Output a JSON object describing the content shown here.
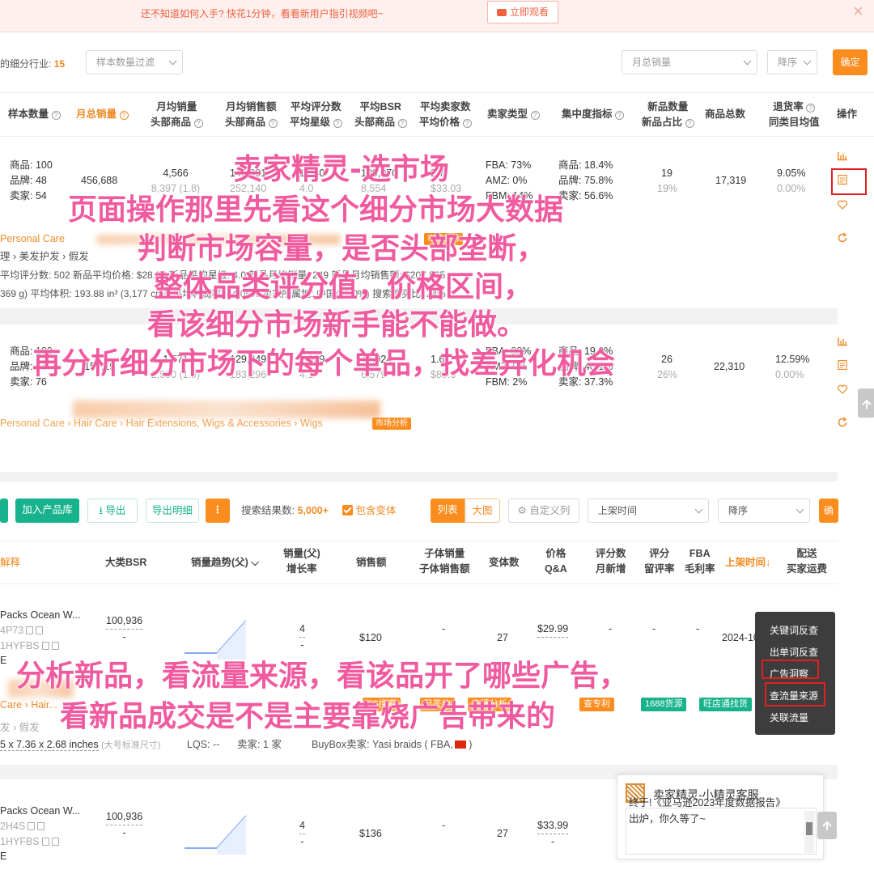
{
  "banner": {
    "text": "还不知道如何入手? 快花1分钟，看看新用户指引视频吧~",
    "watch_label": "立即观看"
  },
  "filter": {
    "label_prefix": "的细分行业:",
    "count": "15",
    "sample_placeholder": "样本数量过滤",
    "sort_field": "月总销量",
    "sort_order": "降序",
    "confirm": "确定"
  },
  "market_headers": [
    {
      "l1": "样本数量",
      "l2": ""
    },
    {
      "l1": "月总销量",
      "l2": ""
    },
    {
      "l1": "月均销量",
      "l2": "头部商品"
    },
    {
      "l1": "月均销售额",
      "l2": "头部商品"
    },
    {
      "l1": "平均评分数",
      "l2": "平均星级"
    },
    {
      "l1": "平均BSR",
      "l2": "头部商品"
    },
    {
      "l1": "平均卖家数",
      "l2": "平均价格"
    },
    {
      "l1": "卖家类型",
      "l2": ""
    },
    {
      "l1": "集中度指标",
      "l2": ""
    },
    {
      "l1": "新品数量",
      "l2": "新品占比"
    },
    {
      "l1": "商品总数",
      "l2": ""
    },
    {
      "l1": "退货率",
      "l2": "同类目均值"
    },
    {
      "l1": "操作",
      "l2": ""
    }
  ],
  "row1": {
    "sample": [
      "商品: 100",
      "品牌: 48",
      "卖家: 54"
    ],
    "monthly_total": "456,688",
    "avg_sales": "4,566",
    "avg_sales_top": "8,397 (1.8)",
    "avg_revenue": "145,091",
    "avg_revenue_top": "252,140",
    "rating_count": "1,540",
    "rating_star": "4.0",
    "bsr": "109,070",
    "bsr_top": "8,554",
    "sellers": "2.7",
    "price": "$33.03",
    "seller_type": [
      "FBA: 73%",
      "AMZ: 0%",
      "FBM: 14%"
    ],
    "concentration": [
      "商品: 18.4%",
      "品牌: 75.8%",
      "卖家: 56.6%"
    ],
    "new_count": "19",
    "new_pct": "19%",
    "total": "17,319",
    "return_rate": "9.05%",
    "return_avg": "0.00%",
    "category": "Personal Care",
    "path": "理 › 美发护发 › 假发",
    "tag": "市场分析",
    "meta1": "平均评分数: 502    新品平均价格: $28.03    新品平均星级: 4.0    新品月均销量: 249    新品月均销售额: $207,565",
    "meta2": "369 g)    平均体积: 193.88 in³ (3,177 cm³)    平均利润率: 64.05%    卖家所属地: 中国(75.0%)    搜索购买比: 24%"
  },
  "row2": {
    "sample": [
      "商品: 100",
      "品牌: 74",
      "卖家: 76"
    ],
    "monthly_total": "157,19",
    "avg_sales": "1,571",
    "avg_sales_top": "2,990 (1.9)",
    "avg_revenue": "129,949",
    "avg_revenue_top": "183,296",
    "rating_count": "1,929",
    "rating_star": "4.1",
    "bsr": "44,924",
    "bsr_top": "6,579",
    "sellers": "1.6",
    "price": "$88.3",
    "seller_type": [
      "FBA: 88%",
      "AMZ: 0%",
      "FBM: 2%"
    ],
    "concentration": [
      "商品: 19.0%",
      "品牌: 40.1%",
      "卖家: 37.3%"
    ],
    "new_count": "26",
    "new_pct": "26%",
    "total": "22,310",
    "return_rate": "12.59%",
    "return_avg": "0.00%",
    "category": "Personal Care › Hair Care › Hair Extensions, Wigs & Accessories › Wigs",
    "tag": "市场分析"
  },
  "toolbar": {
    "add_library": "加入产品库",
    "export": "导出",
    "export_detail": "导出明细",
    "result_label": "搜索结果数:",
    "result_count": "5,000+",
    "include_variants": "包含变体",
    "view_list": "列表",
    "view_grid": "大图",
    "custom_columns": "自定义列",
    "sort_field": "上架时间",
    "sort_order": "降序",
    "confirm": "确"
  },
  "product_headers": [
    {
      "l1": "解释",
      "l2": ""
    },
    {
      "l1": "大类BSR",
      "l2": ""
    },
    {
      "l1": "销量趋势(父)",
      "l2": ""
    },
    {
      "l1": "销量(父)",
      "l2": "增长率"
    },
    {
      "l1": "销售额",
      "l2": ""
    },
    {
      "l1": "子体销量",
      "l2": "子体销售额"
    },
    {
      "l1": "变体数",
      "l2": ""
    },
    {
      "l1": "价格",
      "l2": "Q&A"
    },
    {
      "l1": "评分数",
      "l2": "月新增"
    },
    {
      "l1": "评分",
      "l2": "留评率"
    },
    {
      "l1": "FBA",
      "l2": "毛利率"
    },
    {
      "l1": "上架时间↓",
      "l2": ""
    },
    {
      "l1": "配送",
      "l2": "买家运费"
    }
  ],
  "product1": {
    "title": "Packs Ocean W...",
    "asin": "4P73",
    "parent": "1HYFBS",
    "extra": "E",
    "bsr": "100,936",
    "bsr_sub": "-",
    "sales": "4",
    "growth": "-",
    "revenue": "$120",
    "child": "-",
    "variants": "27",
    "price": "$29.99",
    "ratings": "-",
    "star": "-",
    "fba": "-",
    "date": "2024-10-18",
    "category": "Care › Hair...",
    "path": "发 › 假发",
    "size": "5 x 7.36 x 2.68 inches",
    "size_type": "(大号标准尺寸)",
    "lqs": "LQS: --",
    "sellers": "卖家: 1 家",
    "buybox": "BuyBox卖家:  Yasi braids ( FBA,",
    "badges": [
      "ES搜索",
      "已签约",
      "市场分析",
      "查专利",
      "1688货源",
      "旺店通找货"
    ]
  },
  "product2": {
    "title": "Packs Ocean W...",
    "asin": "2H4S",
    "parent": "1HYFBS",
    "extra": "E",
    "bsr": "100,936",
    "bsr_sub": "-",
    "sales": "4",
    "growth": "-",
    "revenue": "$136",
    "child": "-",
    "variants": "27",
    "price": "$33.99",
    "qa": "-"
  },
  "action_menu": [
    "关键词反查",
    "出单词反查",
    "广告洞察",
    "查流量来源",
    "关联流量"
  ],
  "chat": {
    "title": "卖家精灵-小精灵客服",
    "message": "终于!《亚马逊2023年度数据报告》出炉，你久等了~"
  },
  "overlay": {
    "line1": "卖家精灵-选市场",
    "line2": "页面操作那里先看这个细分市场大数据",
    "line3": "判断市场容量，是否头部垄断，",
    "line4": "整体品类评分值，价格区间，",
    "line5": "看该细分市场新手能不能做。",
    "line6": "再分析细分市场下的每个单品，找差异化机会",
    "line7": "分析新品，看流量来源，看该品开了哪些广告，",
    "line8": "看新品成交是不是主要靠烧广告带来的"
  },
  "colors": {
    "accent": "#fb8c1e",
    "green": "#18b28c",
    "overlay": "#f05a9e",
    "highlight": "#e02020"
  }
}
